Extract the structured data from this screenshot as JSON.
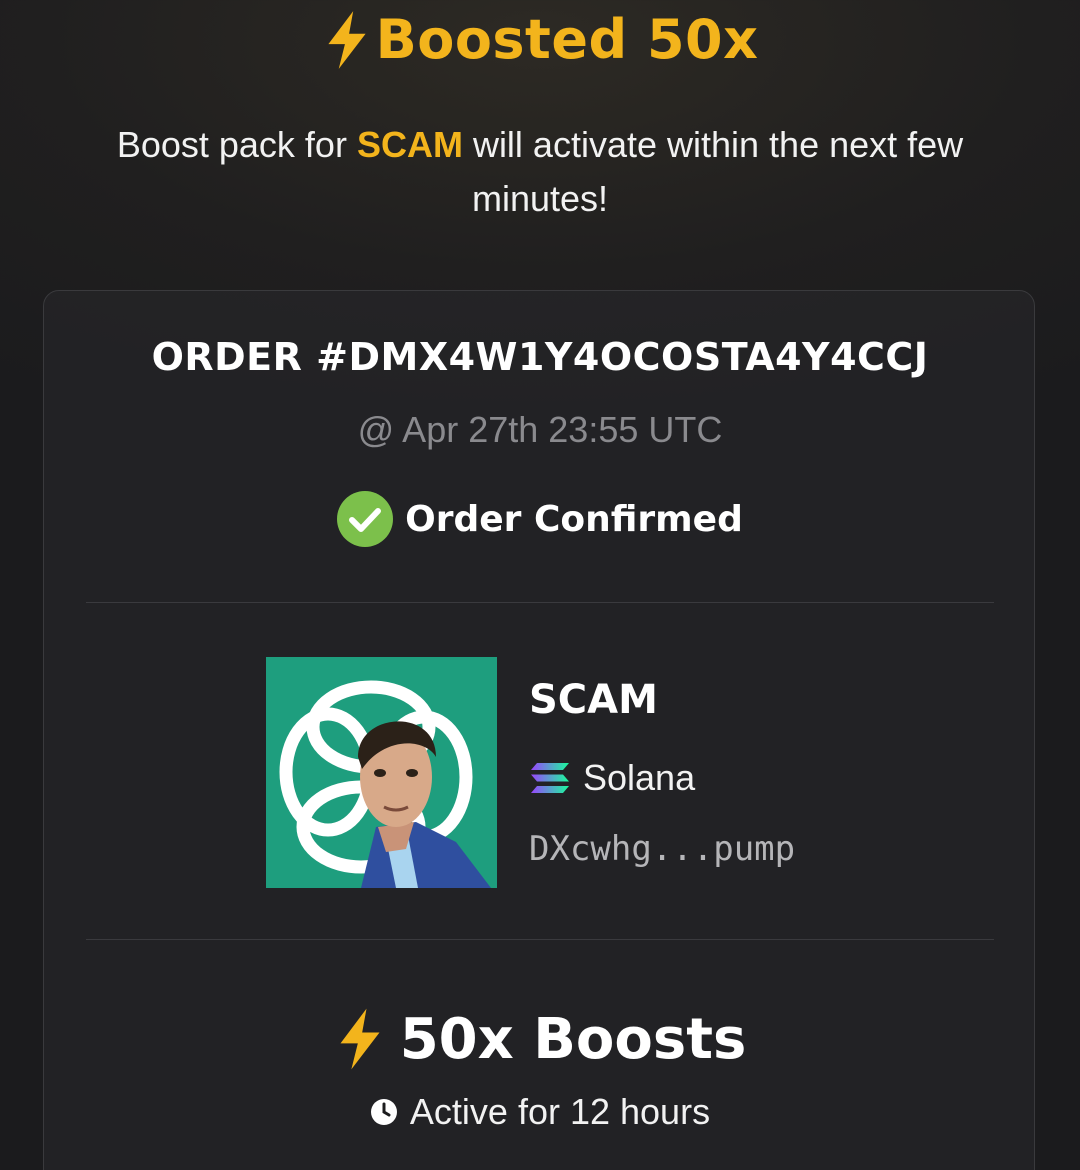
{
  "header": {
    "title": "Boosted 50x",
    "subtitle_prefix": "Boost pack for ",
    "subtitle_token": "SCAM",
    "subtitle_suffix": " will activate within the next few minutes!"
  },
  "order": {
    "id_label": "ORDER #DMX4W1Y4OCOSTA4Y4CCJ",
    "timestamp": "@ Apr 27th 23:55 UTC",
    "status": "Order Confirmed"
  },
  "token": {
    "name": "SCAM",
    "chain": "Solana",
    "address": "DXcwhg...pump"
  },
  "boost": {
    "label": "50x Boosts",
    "duration": "Active for 12 hours"
  },
  "colors": {
    "accent": "#f3b41c",
    "confirmed_green": "#7cc04b",
    "avatar_bg": "#1e9e7e"
  },
  "icons": {
    "title": "lightning-icon",
    "status": "check-circle-icon",
    "chain": "solana-icon",
    "boost": "lightning-icon",
    "duration": "clock-icon"
  }
}
